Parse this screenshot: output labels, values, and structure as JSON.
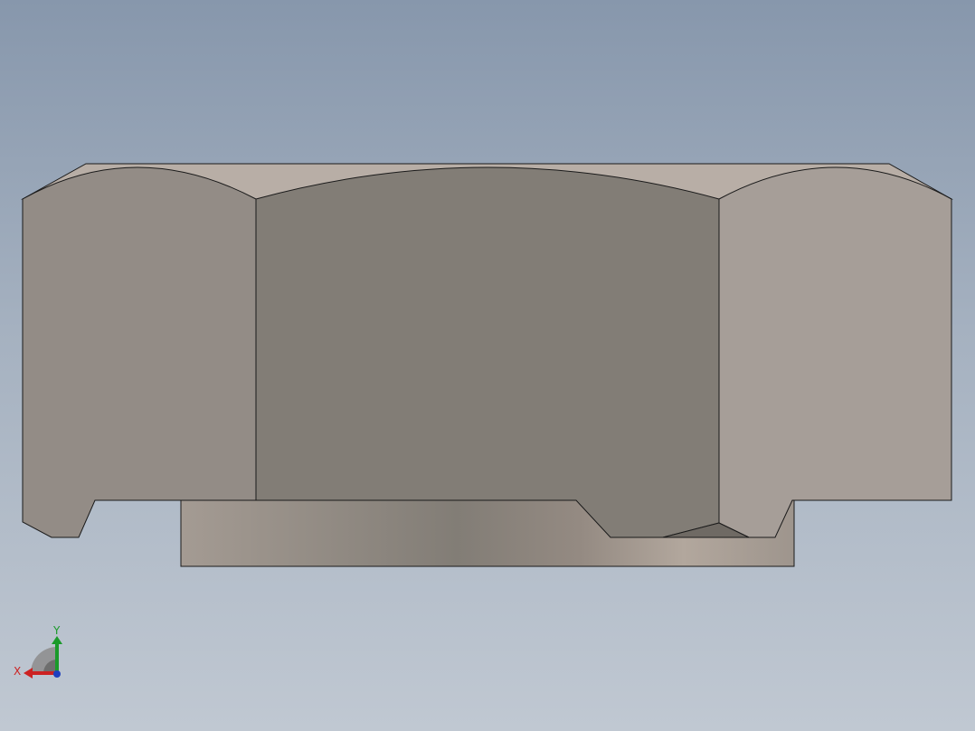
{
  "viewport": {
    "name": "3d-graphics-area"
  },
  "model": {
    "name": "hex-nut-side-view",
    "colors": {
      "top_chamfer": "#b8aea6",
      "left_face": "#938c86",
      "center_face": "#827d76",
      "right_face": "#a69e98",
      "washer_face_light": "#a49b92",
      "washer_face_dark": "#827d76",
      "outline": "#1a1a1a"
    }
  },
  "triad": {
    "x_label": "X",
    "y_label": "Y",
    "colors": {
      "x_axis": "#cc2222",
      "y_axis": "#1a9a2a",
      "z_axis": "#1f3fbf"
    }
  }
}
